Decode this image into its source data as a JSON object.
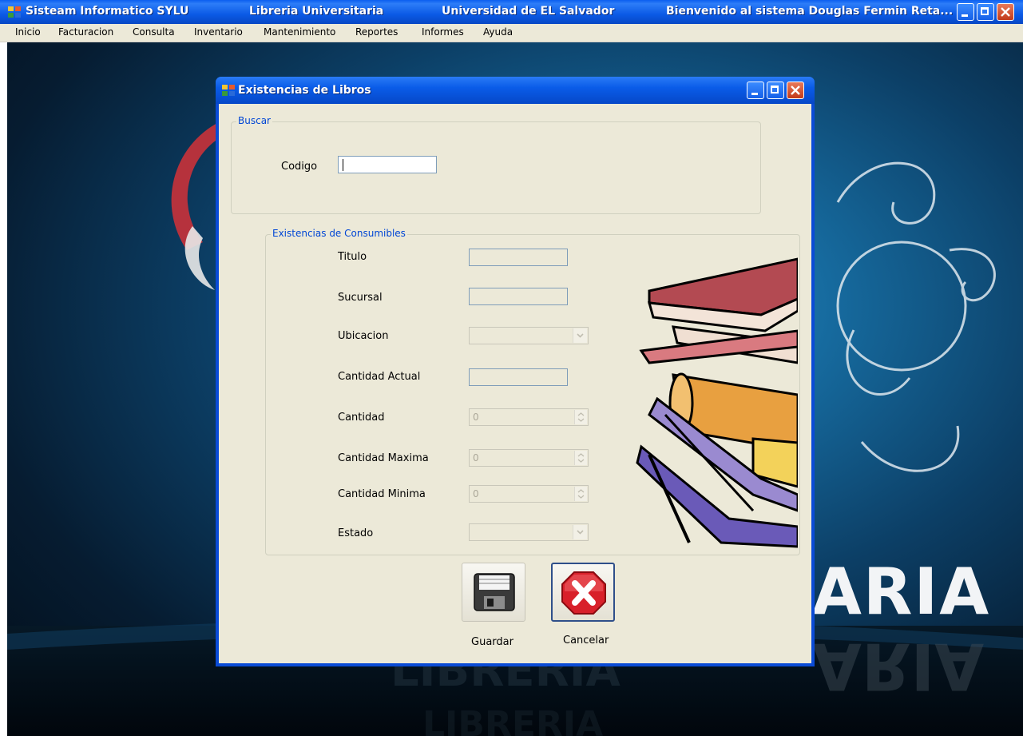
{
  "window": {
    "title_parts": [
      "Sisteam Informatico SYLU",
      "Libreria Universitaria",
      "Universidad de EL Salvador",
      "Bienvenido al sistema Douglas Fermin Reta..."
    ]
  },
  "menu": [
    "Inicio",
    "Facturacion",
    "Consulta",
    "Inventario",
    "Mantenimiento",
    "Reportes",
    "Informes",
    "Ayuda"
  ],
  "background": {
    "banner_text": "ARIA"
  },
  "dialog": {
    "title": "Existencias de Libros",
    "search_group": {
      "legend": "Buscar",
      "codigo_label": "Codigo",
      "codigo_value": ""
    },
    "stock_group": {
      "legend": "Existencias de Consumibles",
      "titulo_label": "Titulo",
      "sucursal_label": "Sucursal",
      "ubicacion_label": "Ubicacion",
      "cantidad_actual_label": "Cantidad Actual",
      "cantidad_label": "Cantidad",
      "cantidad_value": "0",
      "cantidad_maxima_label": "Cantidad Maxima",
      "cantidad_maxima_value": "0",
      "cantidad_minima_label": "Cantidad Minima",
      "cantidad_minima_value": "0",
      "estado_label": "Estado"
    },
    "buttons": {
      "guardar": "Guardar",
      "cancelar": "Cancelar"
    }
  },
  "colors": {
    "xp_blue": "#0a5ce8",
    "dialog_bg": "#ece9d8",
    "legend_blue": "#0046d5",
    "close_red": "#c23a1a"
  }
}
